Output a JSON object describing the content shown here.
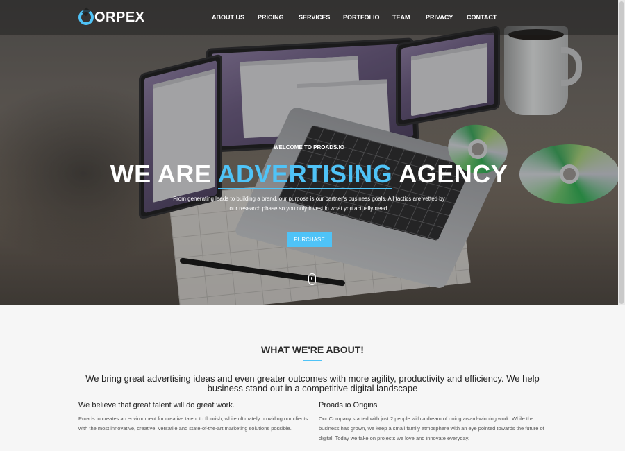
{
  "brand": {
    "logo_text": "ORPEX",
    "accent_color": "#4fc3f7"
  },
  "nav": {
    "items": [
      "ABOUT US",
      "PRICING",
      "SERVICES",
      "PORTFOLIO",
      "TEAM",
      "PRIVACY",
      "CONTACT"
    ]
  },
  "hero": {
    "welcome": "WELCOME TO PROADS.IO",
    "headline_prefix": "WE ARE",
    "headline_accent": "ADVERTISING",
    "headline_suffix": "AGENCY",
    "description_line1": "From generating leads to building a brand, our purpose is our partner's business goals. All tactics are vetted by",
    "description_line2": "our research phase so you only invest in what you actually need.",
    "button_label": "PURCHASE"
  },
  "about": {
    "title": "WHAT WE'RE ABOUT!",
    "lead": "We bring great advertising ideas and even greater outcomes with more agility, productivity and efficiency. We help business stand out in a competitive digital landscape",
    "columns": [
      {
        "heading": "We believe that great talent will do great work.",
        "body": "Proads.io creates an environment for creative talent to flourish, while ultimately providing our clients with the most innovative, creative, versatile and state-of-the-art marketing solutions possible."
      },
      {
        "heading": "Proads.io Origins",
        "body": "Our Company started with just 2 people with a dream of doing award-winning work. While the business has grown, we keep a small family atmosphere with an eye pointed towards the future of digital. Today we take on projects we love and innovate everyday."
      }
    ]
  }
}
